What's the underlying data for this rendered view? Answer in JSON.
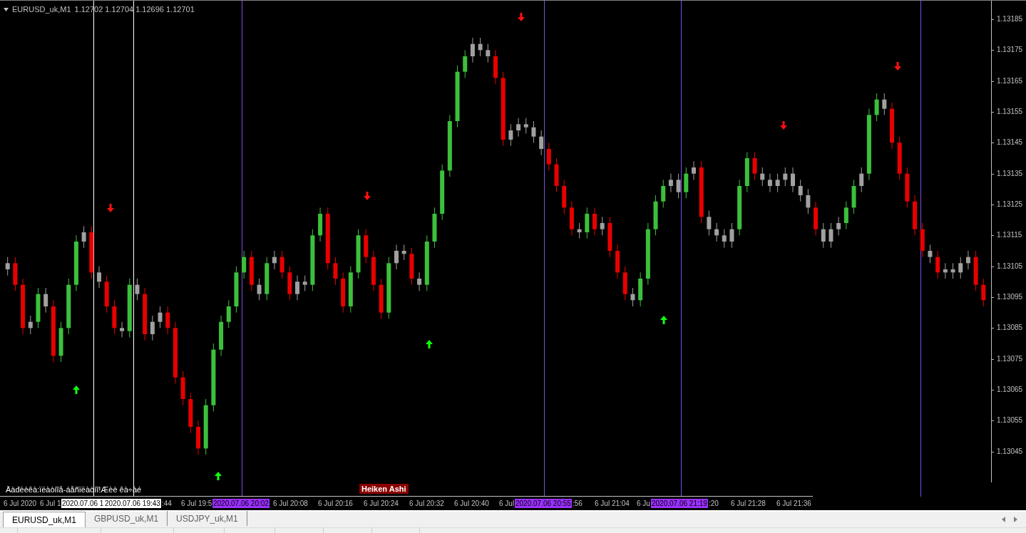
{
  "chart": {
    "symbol": "EURUSD_uk,M1",
    "ohlc": "1.12702 1.12704 1.12696 1.12701",
    "chart_data": {
      "type": "candlestick",
      "categories": [
        null,
        null,
        null,
        null,
        null,
        null,
        null,
        null,
        null,
        null,
        null,
        null,
        null,
        null,
        null,
        null,
        null,
        null,
        null,
        null,
        null,
        null,
        null,
        null,
        null,
        null,
        null,
        null,
        null,
        null,
        null,
        null,
        null,
        null,
        null,
        null,
        null,
        null,
        null,
        null,
        null,
        null,
        null,
        null,
        null,
        null,
        null,
        null,
        null,
        null,
        null,
        null,
        null,
        null,
        null,
        null,
        null,
        null,
        null,
        null,
        null,
        null,
        null,
        null,
        null,
        null,
        null,
        null,
        null,
        null,
        null,
        null,
        null,
        null,
        null,
        null,
        null,
        null,
        null,
        null,
        null,
        null,
        null,
        null,
        null,
        null,
        null,
        null,
        null,
        null,
        null,
        null,
        null,
        null,
        null,
        null,
        null,
        null,
        null,
        null,
        null,
        null,
        null,
        null,
        null,
        null,
        null,
        null,
        null,
        null,
        null,
        null,
        null,
        null,
        null,
        null,
        null,
        null,
        null,
        null,
        null,
        null,
        null,
        null,
        null,
        null,
        null,
        null,
        null
      ],
      "ohlc": [
        [
          1.13104,
          1.13108,
          1.13102,
          1.13106
        ],
        [
          1.13106,
          1.13108,
          1.13097,
          1.13099
        ],
        [
          1.13099,
          1.13101,
          1.13083,
          1.13085
        ],
        [
          1.13085,
          1.13089,
          1.13083,
          1.13087
        ],
        [
          1.13087,
          1.13098,
          1.13085,
          1.13096
        ],
        [
          1.13096,
          1.13098,
          1.1309,
          1.13092
        ],
        [
          1.13092,
          1.13094,
          1.13074,
          1.13076
        ],
        [
          1.13076,
          1.13087,
          1.13074,
          1.13085
        ],
        [
          1.13085,
          1.13101,
          1.13083,
          1.13099
        ],
        [
          1.13099,
          1.13115,
          1.13097,
          1.13113
        ],
        [
          1.13113,
          1.13118,
          1.13111,
          1.13116
        ],
        [
          1.13116,
          1.13118,
          1.13101,
          1.13103
        ],
        [
          1.13103,
          1.13105,
          1.13098,
          1.131
        ],
        [
          1.131,
          1.13102,
          1.1309,
          1.13092
        ],
        [
          1.13092,
          1.13094,
          1.13083,
          1.13085
        ],
        [
          1.13085,
          1.13087,
          1.13082,
          1.13084
        ],
        [
          1.13084,
          1.13101,
          1.13082,
          1.13099
        ],
        [
          1.13099,
          1.13101,
          1.13094,
          1.13096
        ],
        [
          1.13096,
          1.13098,
          1.13081,
          1.13083
        ],
        [
          1.13083,
          1.13089,
          1.13081,
          1.13087
        ],
        [
          1.13087,
          1.13092,
          1.13085,
          1.1309
        ],
        [
          1.1309,
          1.13092,
          1.13083,
          1.13085
        ],
        [
          1.13085,
          1.13087,
          1.13067,
          1.13069
        ],
        [
          1.13069,
          1.13071,
          1.1306,
          1.13062
        ],
        [
          1.13062,
          1.13064,
          1.13051,
          1.13053
        ],
        [
          1.13053,
          1.13055,
          1.13044,
          1.13046
        ],
        [
          1.13046,
          1.13062,
          1.13044,
          1.1306
        ],
        [
          1.1306,
          1.1308,
          1.13058,
          1.13078
        ],
        [
          1.13078,
          1.13089,
          1.13076,
          1.13087
        ],
        [
          1.13087,
          1.13094,
          1.13085,
          1.13092
        ],
        [
          1.13092,
          1.13105,
          1.1309,
          1.13103
        ],
        [
          1.13103,
          1.1311,
          1.13101,
          1.13108
        ],
        [
          1.13108,
          1.1311,
          1.13097,
          1.13099
        ],
        [
          1.13099,
          1.13101,
          1.13094,
          1.13096
        ],
        [
          1.13096,
          1.13108,
          1.13094,
          1.13106
        ],
        [
          1.13106,
          1.1311,
          1.13104,
          1.13108
        ],
        [
          1.13108,
          1.1311,
          1.13101,
          1.13103
        ],
        [
          1.13103,
          1.13105,
          1.13094,
          1.13096
        ],
        [
          1.13096,
          1.13102,
          1.13094,
          1.131
        ],
        [
          1.131,
          1.13102,
          1.13097,
          1.13099
        ],
        [
          1.13099,
          1.13117,
          1.13097,
          1.13115
        ],
        [
          1.13115,
          1.13124,
          1.13113,
          1.13122
        ],
        [
          1.13122,
          1.13124,
          1.13104,
          1.13106
        ],
        [
          1.13106,
          1.13108,
          1.13099,
          1.13101
        ],
        [
          1.13101,
          1.13103,
          1.1309,
          1.13092
        ],
        [
          1.13092,
          1.13105,
          1.1309,
          1.13103
        ],
        [
          1.13103,
          1.13117,
          1.13101,
          1.13115
        ],
        [
          1.13115,
          1.13117,
          1.13106,
          1.13108
        ],
        [
          1.13108,
          1.1311,
          1.13097,
          1.13099
        ],
        [
          1.13099,
          1.13101,
          1.13088,
          1.1309
        ],
        [
          1.1309,
          1.13108,
          1.13088,
          1.13106
        ],
        [
          1.13106,
          1.13112,
          1.13104,
          1.1311
        ],
        [
          1.1311,
          1.13112,
          1.13107,
          1.13109
        ],
        [
          1.13109,
          1.13111,
          1.13099,
          1.13101
        ],
        [
          1.13101,
          1.13103,
          1.13097,
          1.13099
        ],
        [
          1.13099,
          1.13115,
          1.13097,
          1.13113
        ],
        [
          1.13113,
          1.13124,
          1.13111,
          1.13122
        ],
        [
          1.13122,
          1.13138,
          1.1312,
          1.13136
        ],
        [
          1.13136,
          1.13154,
          1.13134,
          1.13152
        ],
        [
          1.13152,
          1.1317,
          1.1315,
          1.13168
        ],
        [
          1.13168,
          1.13175,
          1.13166,
          1.13173
        ],
        [
          1.13173,
          1.13179,
          1.13171,
          1.13177
        ],
        [
          1.13177,
          1.13179,
          1.13173,
          1.13175
        ],
        [
          1.13175,
          1.13177,
          1.13171,
          1.13173
        ],
        [
          1.13173,
          1.13175,
          1.13164,
          1.13166
        ],
        [
          1.13166,
          1.13168,
          1.13144,
          1.13146
        ],
        [
          1.13146,
          1.13151,
          1.13144,
          1.13149
        ],
        [
          1.13149,
          1.13153,
          1.13147,
          1.13151
        ],
        [
          1.13151,
          1.13153,
          1.13148,
          1.1315
        ],
        [
          1.1315,
          1.13152,
          1.13145,
          1.13147
        ],
        [
          1.13147,
          1.13149,
          1.13141,
          1.13143
        ],
        [
          1.13143,
          1.13145,
          1.13136,
          1.13138
        ],
        [
          1.13138,
          1.1314,
          1.13129,
          1.13131
        ],
        [
          1.13131,
          1.13133,
          1.13122,
          1.13124
        ],
        [
          1.13124,
          1.13126,
          1.13115,
          1.13117
        ],
        [
          1.13117,
          1.13119,
          1.13114,
          1.13116
        ],
        [
          1.13116,
          1.13124,
          1.13114,
          1.13122
        ],
        [
          1.13122,
          1.13124,
          1.13115,
          1.13117
        ],
        [
          1.13117,
          1.13121,
          1.13115,
          1.13119
        ],
        [
          1.13119,
          1.13121,
          1.13108,
          1.1311
        ],
        [
          1.1311,
          1.13112,
          1.13101,
          1.13103
        ],
        [
          1.13103,
          1.13105,
          1.13094,
          1.13096
        ],
        [
          1.13096,
          1.13098,
          1.13092,
          1.13094
        ],
        [
          1.13094,
          1.13103,
          1.13092,
          1.13101
        ],
        [
          1.13101,
          1.13119,
          1.13099,
          1.13117
        ],
        [
          1.13117,
          1.13128,
          1.13115,
          1.13126
        ],
        [
          1.13126,
          1.13133,
          1.13124,
          1.13131
        ],
        [
          1.13131,
          1.13135,
          1.13129,
          1.13133
        ],
        [
          1.13133,
          1.13135,
          1.13127,
          1.13129
        ],
        [
          1.13129,
          1.13137,
          1.13127,
          1.13135
        ],
        [
          1.13135,
          1.13139,
          1.13133,
          1.13137
        ],
        [
          1.13137,
          1.13139,
          1.13119,
          1.13121
        ],
        [
          1.13121,
          1.13123,
          1.13115,
          1.13117
        ],
        [
          1.13117,
          1.13119,
          1.13113,
          1.13115
        ],
        [
          1.13115,
          1.13117,
          1.13111,
          1.13113
        ],
        [
          1.13113,
          1.13119,
          1.13111,
          1.13117
        ],
        [
          1.13117,
          1.13133,
          1.13115,
          1.13131
        ],
        [
          1.13131,
          1.13142,
          1.13129,
          1.1314
        ],
        [
          1.1314,
          1.13142,
          1.13133,
          1.13135
        ],
        [
          1.13135,
          1.13137,
          1.13131,
          1.13133
        ],
        [
          1.13133,
          1.13135,
          1.13129,
          1.13131
        ],
        [
          1.13131,
          1.13135,
          1.13129,
          1.13133
        ],
        [
          1.13133,
          1.13137,
          1.13131,
          1.13135
        ],
        [
          1.13135,
          1.13137,
          1.13129,
          1.13131
        ],
        [
          1.13131,
          1.13133,
          1.13126,
          1.13128
        ],
        [
          1.13128,
          1.1313,
          1.13122,
          1.13124
        ],
        [
          1.13124,
          1.13126,
          1.13115,
          1.13117
        ],
        [
          1.13117,
          1.13119,
          1.13111,
          1.13113
        ],
        [
          1.13113,
          1.13119,
          1.13111,
          1.13117
        ],
        [
          1.13117,
          1.13121,
          1.13115,
          1.13119
        ],
        [
          1.13119,
          1.13126,
          1.13117,
          1.13124
        ],
        [
          1.13124,
          1.13133,
          1.13122,
          1.13131
        ],
        [
          1.13131,
          1.13137,
          1.13129,
          1.13135
        ],
        [
          1.13135,
          1.13156,
          1.13133,
          1.13154
        ],
        [
          1.13154,
          1.13161,
          1.13152,
          1.13159
        ],
        [
          1.13159,
          1.13161,
          1.13154,
          1.13156
        ],
        [
          1.13156,
          1.13158,
          1.13143,
          1.13145
        ],
        [
          1.13145,
          1.13147,
          1.13133,
          1.13135
        ],
        [
          1.13135,
          1.13137,
          1.13124,
          1.13126
        ],
        [
          1.13126,
          1.13128,
          1.13115,
          1.13117
        ],
        [
          1.13117,
          1.13119,
          1.13108,
          1.1311
        ],
        [
          1.1311,
          1.13112,
          1.13106,
          1.13108
        ],
        [
          1.13108,
          1.1311,
          1.13101,
          1.13103
        ],
        [
          1.13103,
          1.13106,
          1.13101,
          1.13104
        ],
        [
          1.13104,
          1.13106,
          1.13101,
          1.13103
        ],
        [
          1.13103,
          1.13108,
          1.13101,
          1.13106
        ],
        [
          1.13106,
          1.1311,
          1.13104,
          1.13108
        ],
        [
          1.13108,
          1.1311,
          1.13097,
          1.13099
        ],
        [
          1.13099,
          1.13101,
          1.13092,
          1.13094
        ]
      ],
      "colors": [
        "#a0a0a0",
        "#e80000",
        "#e80000",
        "#a0a0a0",
        "#3cc03c",
        "#a0a0a0",
        "#e80000",
        "#3cc03c",
        "#3cc03c",
        "#3cc03c",
        "#a0a0a0",
        "#e80000",
        "#a0a0a0",
        "#e80000",
        "#e80000",
        "#a0a0a0",
        "#3cc03c",
        "#a0a0a0",
        "#e80000",
        "#a0a0a0",
        "#a0a0a0",
        "#e80000",
        "#e80000",
        "#e80000",
        "#e80000",
        "#e80000",
        "#3cc03c",
        "#3cc03c",
        "#3cc03c",
        "#3cc03c",
        "#3cc03c",
        "#3cc03c",
        "#e80000",
        "#a0a0a0",
        "#3cc03c",
        "#a0a0a0",
        "#e80000",
        "#e80000",
        "#a0a0a0",
        "#a0a0a0",
        "#3cc03c",
        "#3cc03c",
        "#e80000",
        "#e80000",
        "#e80000",
        "#3cc03c",
        "#3cc03c",
        "#e80000",
        "#e80000",
        "#e80000",
        "#3cc03c",
        "#a0a0a0",
        "#a0a0a0",
        "#e80000",
        "#a0a0a0",
        "#3cc03c",
        "#3cc03c",
        "#3cc03c",
        "#3cc03c",
        "#3cc03c",
        "#3cc03c",
        "#a0a0a0",
        "#a0a0a0",
        "#a0a0a0",
        "#e80000",
        "#e80000",
        "#a0a0a0",
        "#a0a0a0",
        "#a0a0a0",
        "#a0a0a0",
        "#a0a0a0",
        "#e80000",
        "#e80000",
        "#e80000",
        "#e80000",
        "#a0a0a0",
        "#3cc03c",
        "#e80000",
        "#a0a0a0",
        "#e80000",
        "#e80000",
        "#e80000",
        "#a0a0a0",
        "#3cc03c",
        "#3cc03c",
        "#3cc03c",
        "#3cc03c",
        "#a0a0a0",
        "#a0a0a0",
        "#3cc03c",
        "#a0a0a0",
        "#e80000",
        "#a0a0a0",
        "#a0a0a0",
        "#a0a0a0",
        "#a0a0a0",
        "#3cc03c",
        "#3cc03c",
        "#e80000",
        "#a0a0a0",
        "#a0a0a0",
        "#a0a0a0",
        "#a0a0a0",
        "#a0a0a0",
        "#a0a0a0",
        "#a0a0a0",
        "#e80000",
        "#a0a0a0",
        "#a0a0a0",
        "#a0a0a0",
        "#3cc03c",
        "#3cc03c",
        "#a0a0a0",
        "#3cc03c",
        "#3cc03c",
        "#a0a0a0",
        "#e80000",
        "#e80000",
        "#e80000",
        "#e80000",
        "#e80000",
        "#a0a0a0",
        "#e80000",
        "#a0a0a0",
        "#a0a0a0",
        "#a0a0a0",
        "#a0a0a0",
        "#e80000",
        "#e80000"
      ],
      "ylim": [
        1.13035,
        1.13191
      ],
      "yticks": [
        {
          "value": 1.13185,
          "label": "1.13185"
        },
        {
          "value": 1.13175,
          "label": "1.13175"
        },
        {
          "value": 1.13165,
          "label": "1.13165"
        },
        {
          "value": 1.13155,
          "label": "1.13155"
        },
        {
          "value": 1.13145,
          "label": "1.13145"
        },
        {
          "value": 1.13135,
          "label": "1.13135"
        },
        {
          "value": 1.13125,
          "label": "1.13125"
        },
        {
          "value": 1.13115,
          "label": "1.13115"
        },
        {
          "value": 1.13105,
          "label": "1.13105"
        },
        {
          "value": 1.13095,
          "label": "1.13095"
        },
        {
          "value": 1.13085,
          "label": "1.13085"
        },
        {
          "value": 1.13075,
          "label": "1.13075"
        },
        {
          "value": 1.13065,
          "label": "1.13065"
        },
        {
          "value": 1.13055,
          "label": "1.13055"
        },
        {
          "value": 1.13045,
          "label": "1.13045"
        }
      ]
    },
    "time_axis": [
      {
        "text": "6 Jul 2020",
        "kind": "tick"
      },
      {
        "text": "6 Jul 1",
        "kind": "tick"
      },
      {
        "text": "2020.07.06 1",
        "kind": "cursor"
      },
      {
        "text": "2020.07.06 19:43",
        "kind": "cursor"
      },
      {
        "text": ":44",
        "kind": "tick"
      },
      {
        "text": "6 Jul 19:5",
        "kind": "tick"
      },
      {
        "text": "2020.07.06 20:02",
        "kind": "marker"
      },
      {
        "text": "6 Jul 20:08",
        "kind": "tick"
      },
      {
        "text": "6 Jul 20:16",
        "kind": "tick"
      },
      {
        "text": "6 Jul 20:24",
        "kind": "tick"
      },
      {
        "text": "6 Jul 20:32",
        "kind": "tick"
      },
      {
        "text": "6 Jul 20:40",
        "kind": "tick"
      },
      {
        "text": "6 Jul",
        "kind": "tick"
      },
      {
        "text": "2020.07.06 20:55",
        "kind": "marker"
      },
      {
        "text": ":56",
        "kind": "tick"
      },
      {
        "text": "6 Jul 21:04",
        "kind": "tick"
      },
      {
        "text": "6 Ju",
        "kind": "tick"
      },
      {
        "text": "2020.07.06 21:19",
        "kind": "marker"
      },
      {
        "text": ":20",
        "kind": "tick"
      },
      {
        "text": "6 Jul 21:28",
        "kind": "tick"
      },
      {
        "text": "6 Jul 21:36",
        "kind": "tick"
      }
    ],
    "notice": "Äàđèèêà:ïëàòíîå-áåñïëàòíî!Æèè êà÷àé",
    "indicator_label": "Heiken Ashi"
  },
  "tabs": [
    {
      "label": "EURUSD_uk,M1",
      "selected": true
    },
    {
      "label": "GBPUSD_uk,M1",
      "selected": false
    },
    {
      "label": "USDJPY_uk,M1",
      "selected": false
    }
  ]
}
